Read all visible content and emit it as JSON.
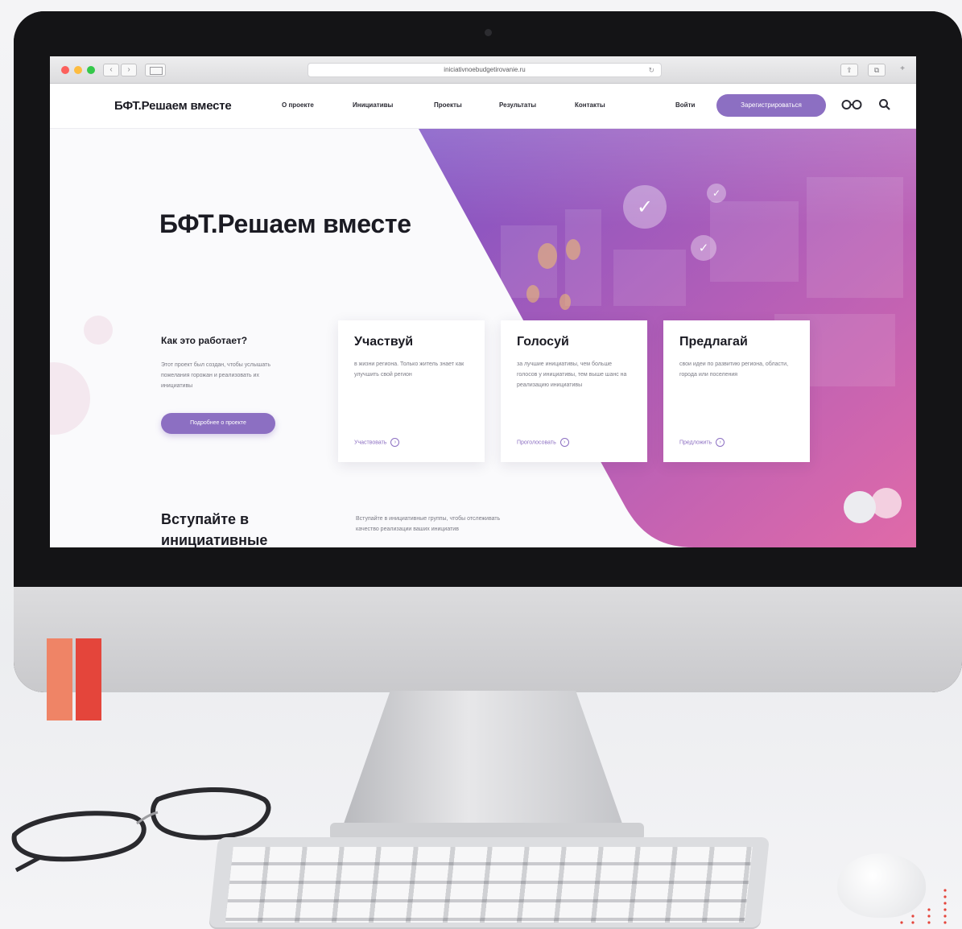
{
  "browser": {
    "url": "iniciativnoebudgetirovanie.ru"
  },
  "header": {
    "logo": "БФТ.Решаем вместе",
    "nav": [
      "О проекте",
      "Инициативы",
      "Проекты",
      "Результаты",
      "Контакты"
    ],
    "login": "Войти",
    "register": "Зарегистрироваться"
  },
  "hero": {
    "title": "БФТ.Решаем вместе"
  },
  "how": {
    "title": "Как это работает?",
    "text": "Этот проект был создан, чтобы услышать пожелания горожан и реализовать их инициативы",
    "button": "Подробнее о проекте"
  },
  "cards": [
    {
      "title": "Участвуй",
      "text": "в жизни региона. Только житель знает как улучшить свой регион",
      "link": "Участвовать"
    },
    {
      "title": "Голосуй",
      "text": "за лучшие инициативы, чем больше голосов у инициативы, тем выше шанс на реализацию инициативы",
      "link": "Проголосовать"
    },
    {
      "title": "Предлагай",
      "text": "свои идеи по развитию региона, области, города или поселения",
      "link": "Предложить"
    }
  ],
  "join": {
    "title": "Вступайте в инициативные",
    "text": "Вступайте в инициативные группы, чтобы отслеживать качество реализации ваших инициатив"
  },
  "colors": {
    "accent": "#8c6fc2",
    "hero_pink": "#e06aa8",
    "hero_purple": "#7d52c4",
    "bar_orange": "#ef8466",
    "bar_red": "#e4453b"
  }
}
